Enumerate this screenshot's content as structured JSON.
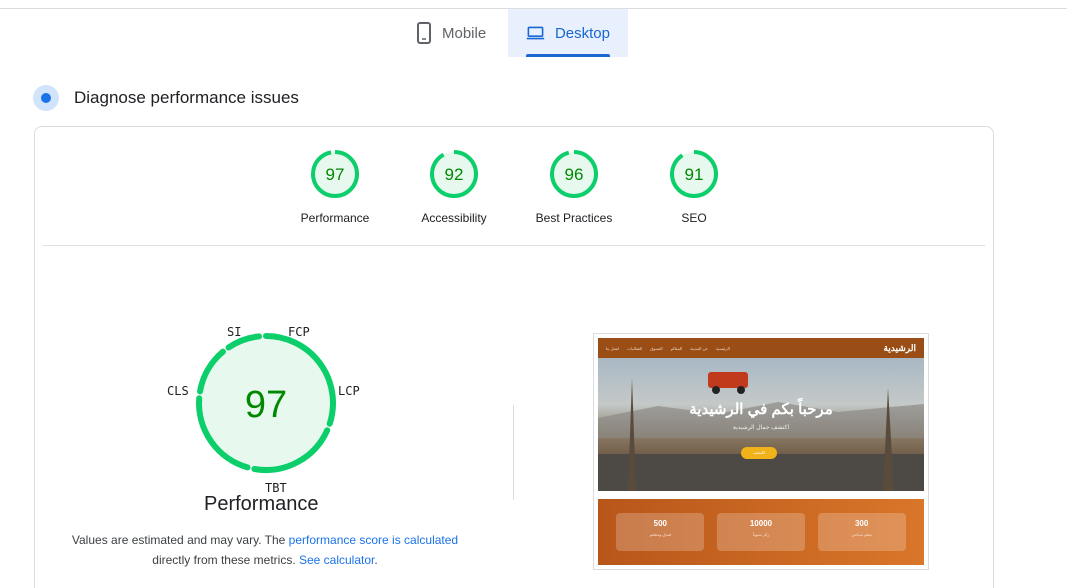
{
  "tabs": [
    {
      "label": "Mobile",
      "icon": "phone-icon",
      "selected": false
    },
    {
      "label": "Desktop",
      "icon": "laptop-icon",
      "selected": true
    }
  ],
  "section": {
    "title": "Diagnose performance issues",
    "icon": "diagnose-icon"
  },
  "categories": [
    {
      "label": "Performance",
      "score": 97
    },
    {
      "label": "Accessibility",
      "score": 92
    },
    {
      "label": "Best Practices",
      "score": 96
    },
    {
      "label": "SEO",
      "score": 91
    }
  ],
  "performance": {
    "score": 97,
    "title": "Performance",
    "metrics": {
      "si": "SI",
      "fcp": "FCP",
      "lcp": "LCP",
      "tbt": "TBT",
      "cls": "CLS"
    },
    "note": {
      "text1": "Values are estimated and may vary. The ",
      "link1": "performance score is calculated",
      "text2": "directly from these metrics. ",
      "link2": "See calculator",
      "text3": "."
    }
  },
  "colors": {
    "pass": "#0cce6b",
    "pass_text": "#008800",
    "pass_bg": "#e7f9ee",
    "accent": "#1967d2"
  },
  "screenshot": {
    "logo": "الرشيدية",
    "nav": [
      "الرئيسية",
      "عن المدينة",
      "المعالم",
      "التسوق",
      "الفعاليات",
      "اتصل بنا"
    ],
    "hero_title": "مرحباً بكم في الرشيدية",
    "hero_subtitle": "اكتشف جمال الرشيدية",
    "hero_button": "اكتشف",
    "stats": [
      {
        "value": "300",
        "label": "معلم سياحي"
      },
      {
        "value": "10000",
        "label": "زائر سنوياً"
      },
      {
        "value": "500",
        "label": "فندق ومطعم"
      }
    ]
  }
}
